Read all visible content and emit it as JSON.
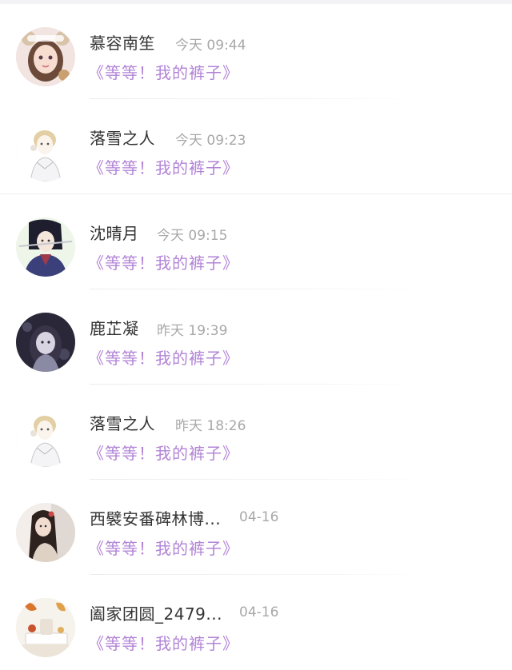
{
  "comments": [
    {
      "name": "慕容南笙",
      "time": "今天 09:44",
      "message": "《等等！我的裤子》",
      "avatar_icon": "anime-girl-bear-ears-avatar"
    },
    {
      "name": "落雪之人",
      "time": "今天 09:23",
      "message": "《等等！我的裤子》",
      "avatar_icon": "sketch-character-avatar"
    },
    {
      "name": "沈晴月",
      "time": "今天 09:15",
      "message": "《等等！我的裤子》",
      "avatar_icon": "ancient-swordsman-avatar"
    },
    {
      "name": "鹿芷凝",
      "time": "昨天 19:39",
      "message": "《等等！我的裤子》",
      "avatar_icon": "dark-fantasy-girl-avatar"
    },
    {
      "name": "落雪之人",
      "time": "昨天 18:26",
      "message": "《等等！我的裤子》",
      "avatar_icon": "sketch-character-avatar"
    },
    {
      "name": "西襞安番碑林博...",
      "time": "04-16",
      "message": "《等等！我的裤子》",
      "avatar_icon": "girl-long-hair-avatar"
    },
    {
      "name": "阖家团圆_2479...",
      "time": "04-16",
      "message": "《等等！我的裤子》",
      "avatar_icon": "autumn-still-life-avatar"
    }
  ],
  "colors": {
    "name": "#333333",
    "time": "#a8a8a8",
    "message": "#b284d6",
    "background": "#ffffff"
  }
}
